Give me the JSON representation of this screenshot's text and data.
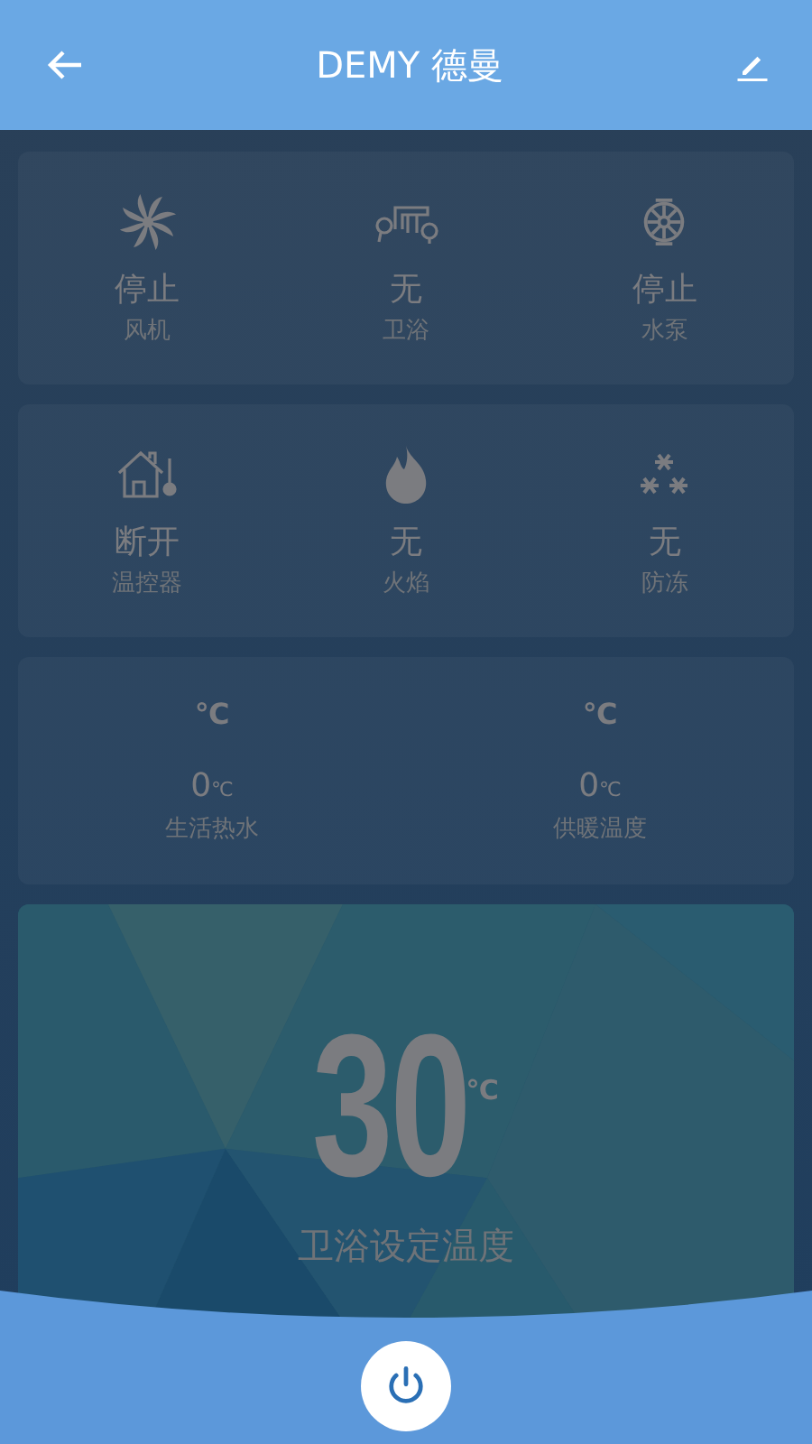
{
  "header": {
    "title": "DEMY 德曼"
  },
  "status_panels": [
    {
      "items": [
        {
          "kind": "fan",
          "state": "停止",
          "label": "风机"
        },
        {
          "kind": "bath",
          "state": "无",
          "label": "卫浴"
        },
        {
          "kind": "pump",
          "state": "停止",
          "label": "水泵"
        }
      ]
    },
    {
      "items": [
        {
          "kind": "thermostat",
          "state": "断开",
          "label": "温控器"
        },
        {
          "kind": "flame",
          "state": "无",
          "label": "火焰"
        },
        {
          "kind": "frost",
          "state": "无",
          "label": "防冻"
        }
      ]
    }
  ],
  "readings": [
    {
      "unit": "℃",
      "value": "0",
      "value_unit": "℃",
      "label": "生活热水"
    },
    {
      "unit": "℃",
      "value": "0",
      "value_unit": "℃",
      "label": "供暖温度"
    }
  ],
  "setpoint": {
    "value": "30",
    "unit": "℃",
    "label": "卫浴设定温度"
  }
}
